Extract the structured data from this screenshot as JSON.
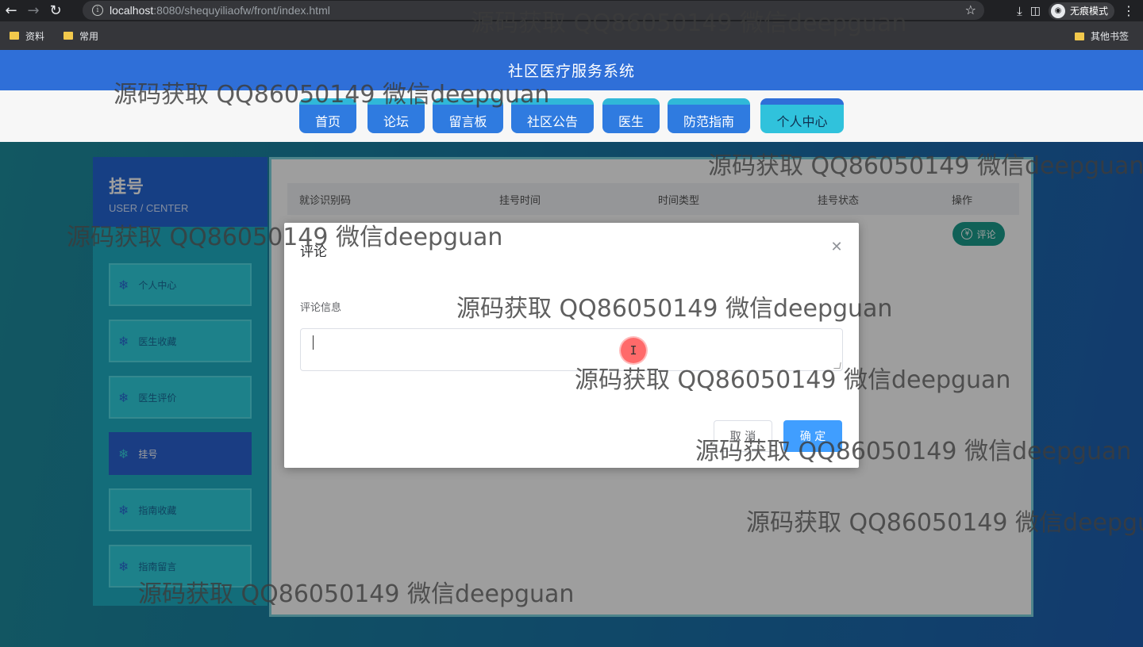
{
  "browser": {
    "url_host": "localhost",
    "url_rest": ":8080/shequyiliaofw/front/index.html",
    "incognito_label": "无痕模式",
    "bookmarks": [
      "资料",
      "常用"
    ],
    "other_bookmarks": "其他书签"
  },
  "site": {
    "title": "社区医疗服务系统",
    "nav": [
      "首页",
      "论坛",
      "留言板",
      "社区公告",
      "医生",
      "防范指南",
      "个人中心"
    ],
    "active_nav": "个人中心"
  },
  "sidebar": {
    "title": "挂号",
    "subtitle": "USER / CENTER",
    "items": [
      "个人中心",
      "医生收藏",
      "医生评价",
      "挂号",
      "指南收藏",
      "指南留言"
    ],
    "active_item": "挂号"
  },
  "table": {
    "headers": [
      "就诊识别码",
      "挂号时间",
      "时间类型",
      "挂号状态",
      "操作"
    ],
    "row_action": "评论"
  },
  "dialog": {
    "title": "评论",
    "field_label": "评论信息",
    "input_value": "",
    "cancel_label": "取 消",
    "confirm_label": "确 定"
  },
  "watermark": "源码获取 QQ86050149 微信deepguan",
  "colors": {
    "header_blue": "#2f6fd8",
    "tab_cyan": "#30c2dc",
    "primary_button": "#409eff",
    "action_green": "#1a9d8d"
  }
}
